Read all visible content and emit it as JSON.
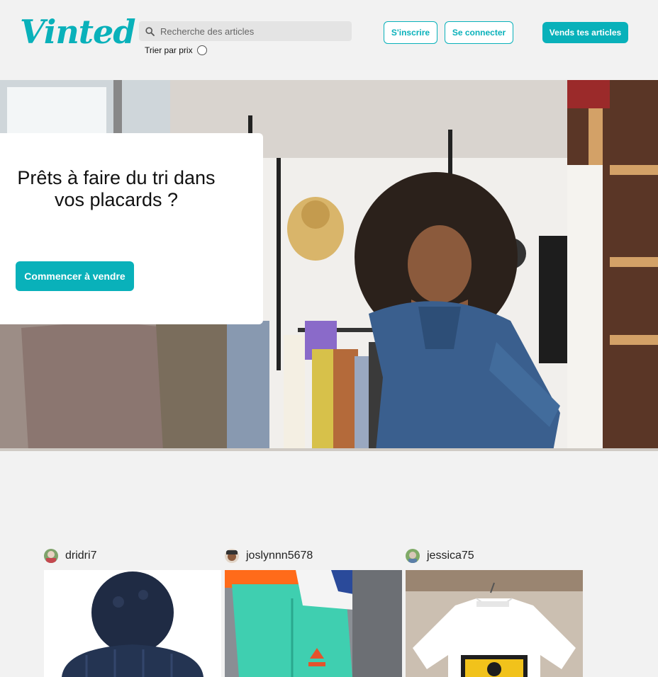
{
  "header": {
    "logo": "Vinted",
    "search": {
      "placeholder": "Recherche des articles",
      "value": ""
    },
    "sort_label": "Trier par prix",
    "signup_label": "S'inscrire",
    "login_label": "Se connecter",
    "sell_label": "Vends tes articles",
    "brand_color": "#09b1ba"
  },
  "hero": {
    "title": "Prêts à faire du tri dans vos placards ?",
    "cta_label": "Commencer à vendre"
  },
  "feed": {
    "items": [
      {
        "username": "dridri7"
      },
      {
        "username": "joslynnn5678"
      },
      {
        "username": "jessica75"
      }
    ]
  }
}
